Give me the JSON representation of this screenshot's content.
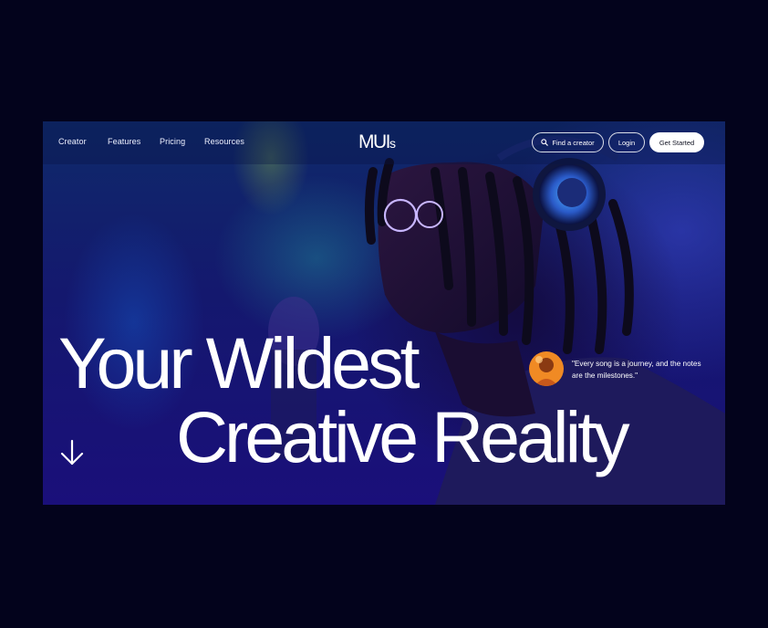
{
  "nav": {
    "links": [
      "Creator",
      "Features",
      "Pricing",
      "Resources"
    ],
    "logo_main": "MUI",
    "logo_suffix": "s",
    "find_creator": "Find a creator",
    "login": "Login",
    "get_started": "Get Started"
  },
  "hero": {
    "headline_line1": "Your Wildest",
    "headline_line2": "Creative Reality",
    "quote": "\"Every song is a journey, and the notes are the milestones.\""
  },
  "icons": {
    "search": "search-icon",
    "scroll_down": "arrow-down-icon"
  },
  "colors": {
    "page_background": "#03031c",
    "hero_blue": "#1a0f7a",
    "accent_orange": "#e8761a"
  }
}
